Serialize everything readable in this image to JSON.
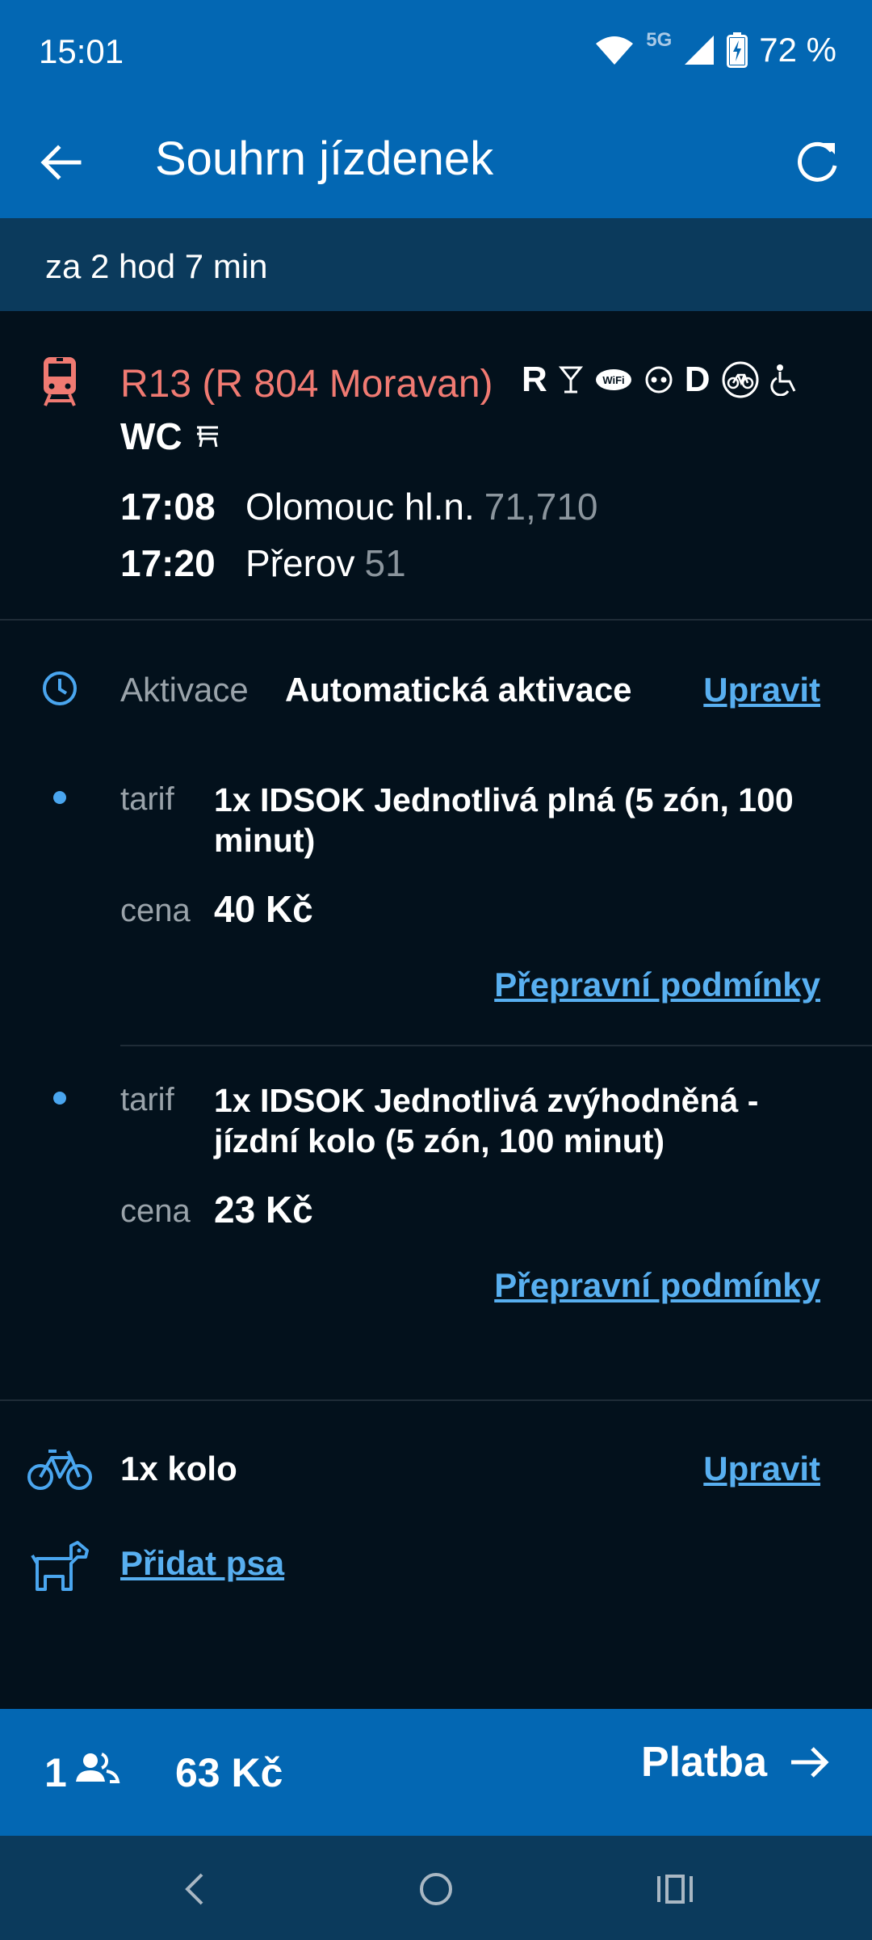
{
  "status_bar": {
    "time": "15:01",
    "network": "5G",
    "battery": "72 %",
    "icons": [
      "wifi-icon",
      "signal-icon",
      "battery-charging-icon"
    ]
  },
  "app_bar": {
    "title": "Souhrn jízdenek",
    "back_icon": "arrow-left-icon",
    "refresh_icon": "refresh-icon"
  },
  "countdown": {
    "text": "za 2 hod 7 min"
  },
  "train": {
    "icon": "train-icon",
    "name": "R13 (R 804 Moravan)",
    "features": [
      "R",
      "restaurant-car-icon",
      "wifi-badge-icon",
      "couchette-icon",
      "D",
      "bicycle-circle-icon",
      "wheelchair-icon"
    ],
    "feature_text": {
      "r": "R",
      "d": "D",
      "wc": "WC"
    },
    "stops": [
      {
        "time": "17:08",
        "station": "Olomouc hl.n.",
        "platform": "71,710"
      },
      {
        "time": "17:20",
        "station": "Přerov",
        "platform": "51"
      }
    ]
  },
  "activation": {
    "label": "Aktivace",
    "value": "Automatická aktivace",
    "edit_label": "Upravit"
  },
  "tickets": [
    {
      "tarif_label": "tarif",
      "tarif": "1x IDSOK Jednotlivá plná (5 zón, 100 minut)",
      "price_label": "cena",
      "price": "40 Kč",
      "conditions_label": "Přepravní podmínky"
    },
    {
      "tarif_label": "tarif",
      "tarif": "1x IDSOK Jednotlivá zvýhodněná - jízdní kolo (5 zón, 100 minut)",
      "price_label": "cena",
      "price": "23 Kč",
      "conditions_label": "Přepravní podmínky"
    }
  ],
  "extras": {
    "bike": {
      "text": "1x kolo",
      "edit_label": "Upravit"
    },
    "dog": {
      "link": "Přidat psa"
    }
  },
  "bottom_bar": {
    "passenger_count": "1",
    "total": "63 Kč",
    "pay_label": "Platba"
  },
  "colors": {
    "primary": "#0367b3",
    "background": "#03111c",
    "countdown_bg": "#0b3a5c",
    "accent_link": "#58aff0",
    "train_name": "#f07a72"
  }
}
